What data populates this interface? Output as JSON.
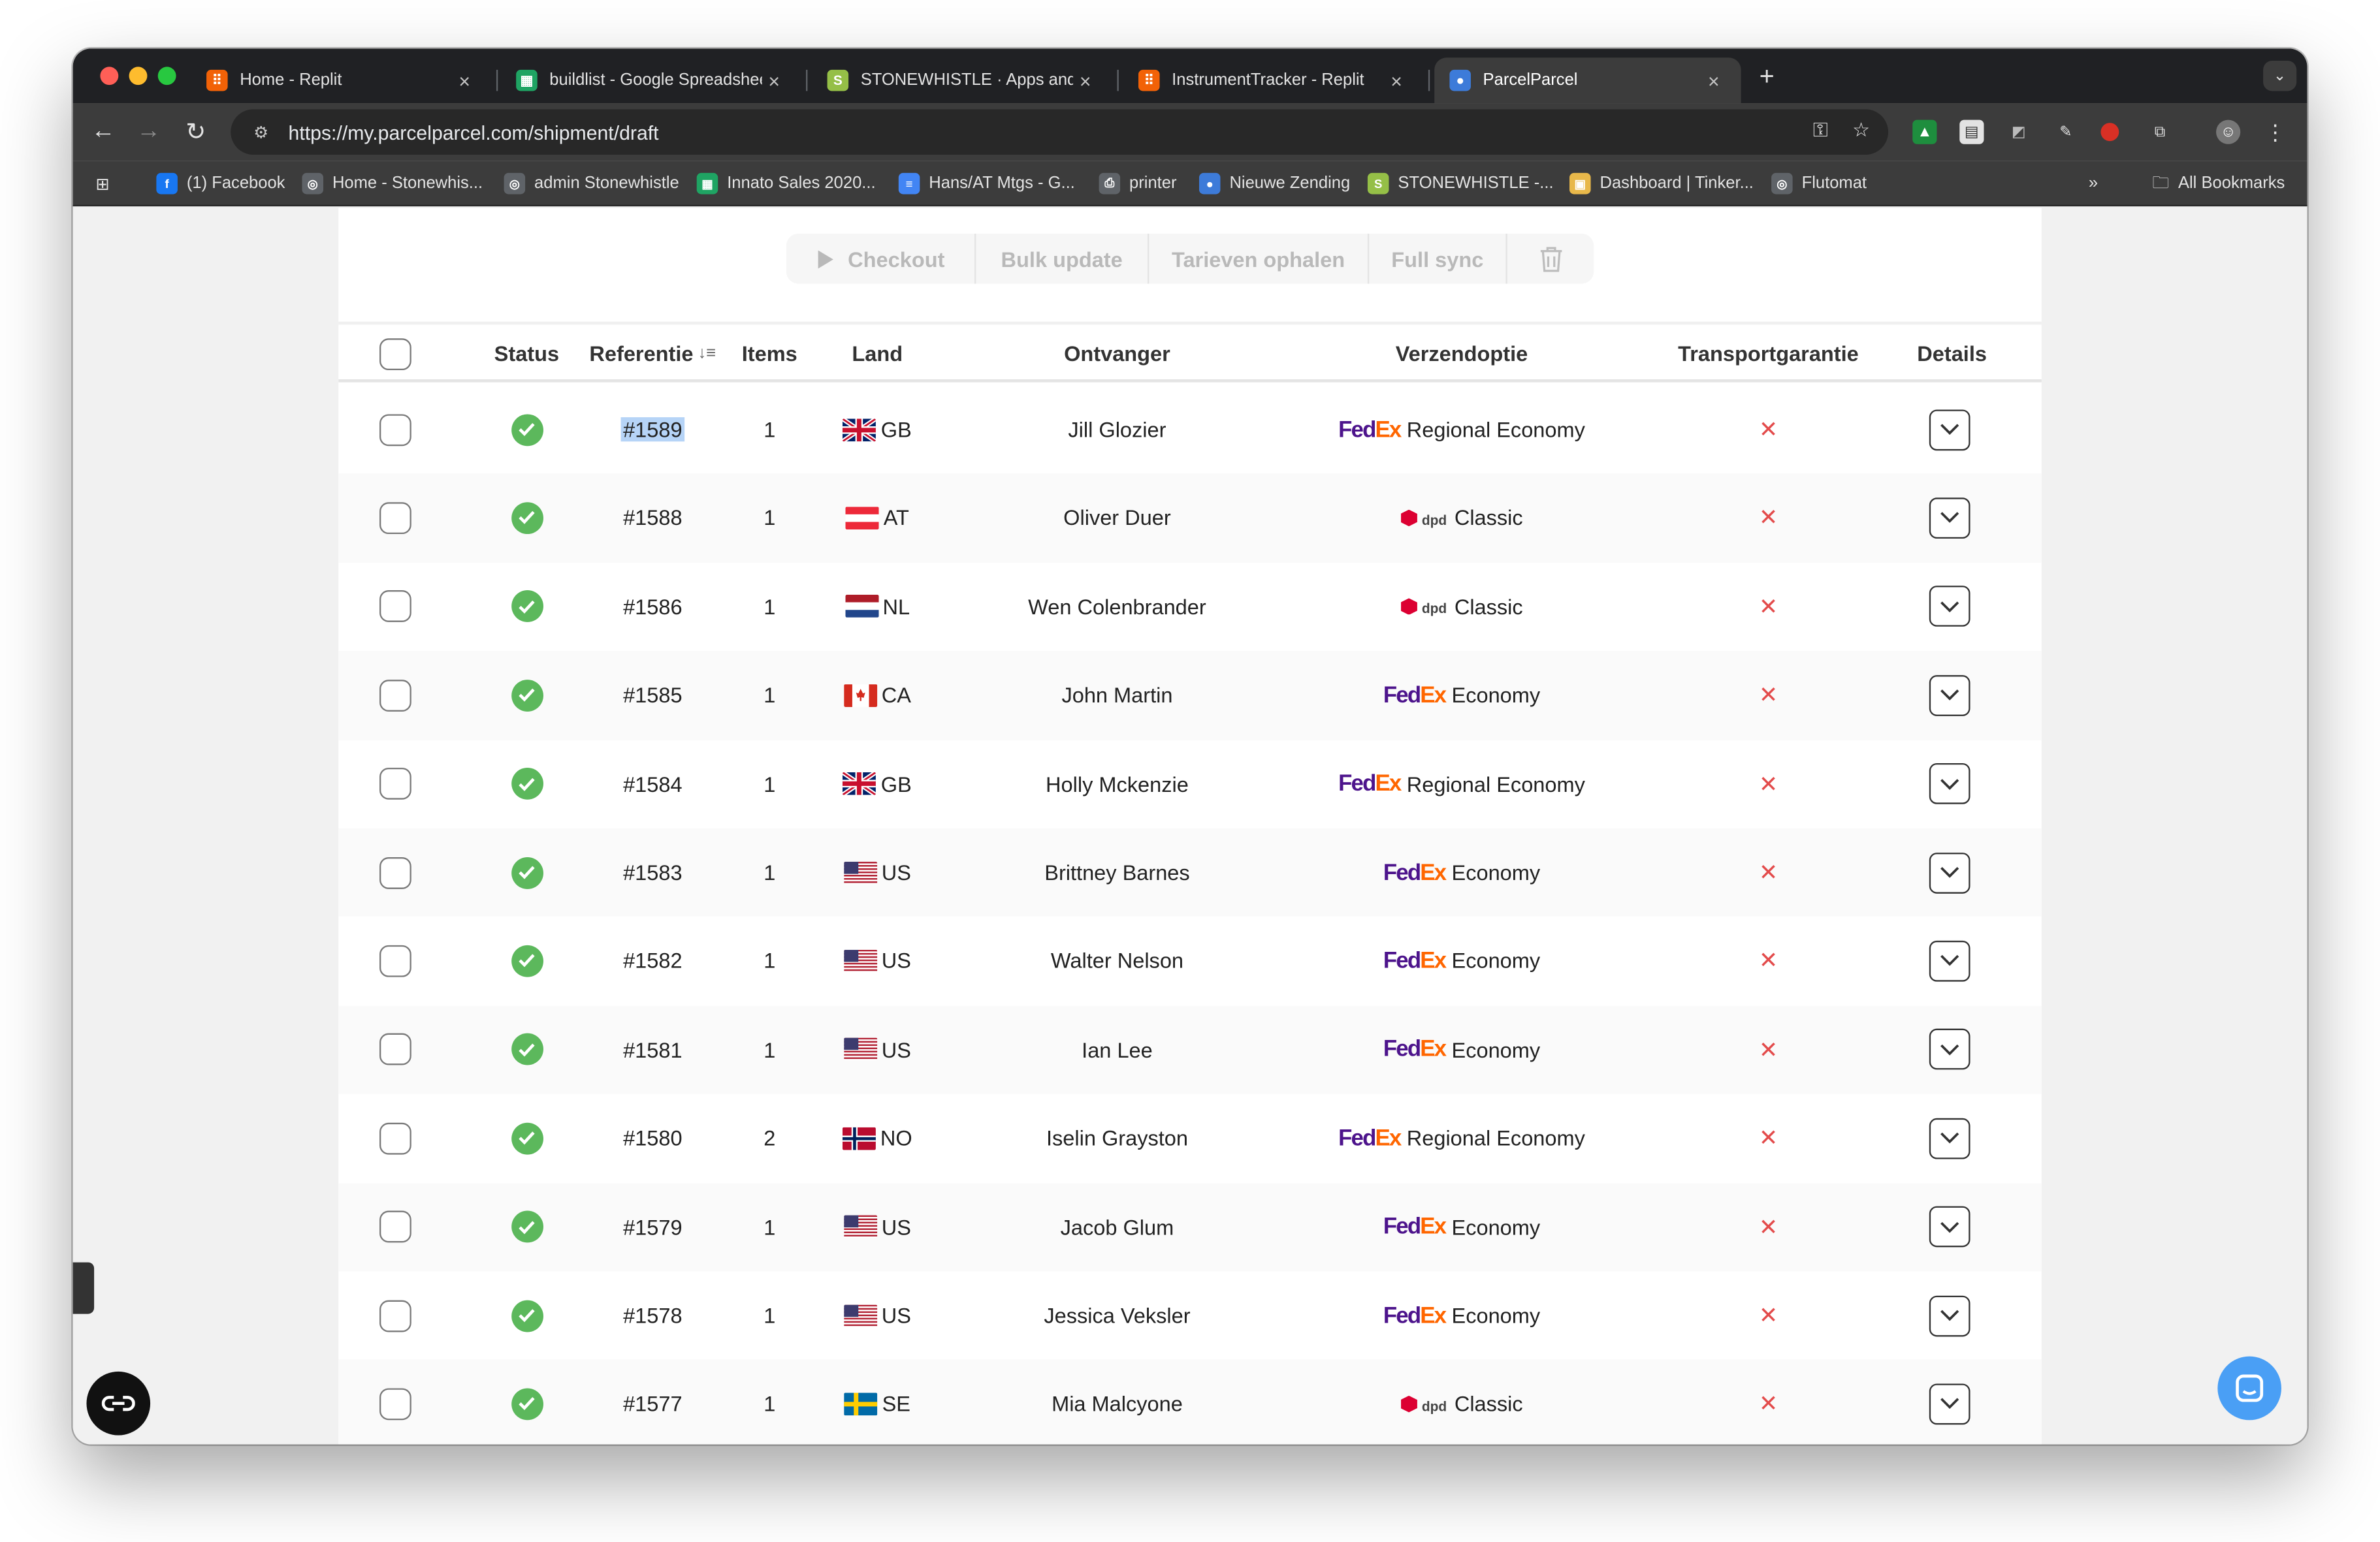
{
  "browser": {
    "tabs": [
      {
        "title": "Home - Replit",
        "icon": "replit-icon",
        "color": "#f26207"
      },
      {
        "title": "buildlist - Google Spreadshee",
        "icon": "sheets-icon",
        "color": "#1fa463"
      },
      {
        "title": "STONEWHISTLE · Apps and s",
        "icon": "shopify-icon",
        "color": "#95bf47"
      },
      {
        "title": "InstrumentTracker - Replit",
        "icon": "replit-icon",
        "color": "#f26207"
      },
      {
        "title": "ParcelParcel",
        "icon": "parcelparcel-icon",
        "color": "#3d7bd9",
        "active": true
      }
    ],
    "url": "https://my.parcelparcel.com/shipment/draft",
    "bookmarks": [
      {
        "label": "(1) Facebook",
        "icon": "facebook-icon",
        "color": "#1877f2"
      },
      {
        "label": "Home - Stonewhis...",
        "icon": "globe-icon",
        "color": "#5f6368"
      },
      {
        "label": "admin Stonewhistle",
        "icon": "globe-icon",
        "color": "#5f6368"
      },
      {
        "label": "Innato Sales 2020...",
        "icon": "sheets-icon",
        "color": "#1fa463"
      },
      {
        "label": "Hans/AT Mtgs - G...",
        "icon": "docs-icon",
        "color": "#4285f4"
      },
      {
        "label": "printer",
        "icon": "printer-icon",
        "color": "#5f6368"
      },
      {
        "label": "Nieuwe Zending",
        "icon": "parcelparcel-icon",
        "color": "#3d7bd9"
      },
      {
        "label": "STONEWHISTLE -...",
        "icon": "shopify-icon",
        "color": "#95bf47"
      },
      {
        "label": "Dashboard | Tinker...",
        "icon": "tinkercad-icon",
        "color": "#e8b84a"
      },
      {
        "label": "Flutomat",
        "icon": "globe-icon",
        "color": "#5f6368"
      }
    ],
    "all_bookmarks": "All Bookmarks"
  },
  "actions": {
    "checkout": "Checkout",
    "bulk_update": "Bulk update",
    "tarieven": "Tarieven ophalen",
    "full_sync": "Full sync"
  },
  "table": {
    "headers": {
      "status": "Status",
      "referentie": "Referentie",
      "items": "Items",
      "land": "Land",
      "ontvanger": "Ontvanger",
      "verzendoptie": "Verzendoptie",
      "transportgarantie": "Transportgarantie",
      "details": "Details"
    },
    "rows": [
      {
        "ref": "#1589",
        "items": "1",
        "country": "GB",
        "recipient": "Jill Glozier",
        "carrier": "fedex",
        "carrier_fe": "Fed",
        "carrier_ex": "Ex",
        "service": "Regional Economy",
        "selected": true
      },
      {
        "ref": "#1588",
        "items": "1",
        "country": "AT",
        "recipient": "Oliver Duer",
        "carrier": "dpd",
        "carrier_label": "dpd",
        "service": "Classic"
      },
      {
        "ref": "#1586",
        "items": "1",
        "country": "NL",
        "recipient": "Wen Colenbrander",
        "carrier": "dpd",
        "carrier_label": "dpd",
        "service": "Classic"
      },
      {
        "ref": "#1585",
        "items": "1",
        "country": "CA",
        "recipient": "John Martin",
        "carrier": "fedex",
        "carrier_fe": "Fed",
        "carrier_ex": "Ex",
        "service": "Economy"
      },
      {
        "ref": "#1584",
        "items": "1",
        "country": "GB",
        "recipient": "Holly Mckenzie",
        "carrier": "fedex",
        "carrier_fe": "Fed",
        "carrier_ex": "Ex",
        "service": "Regional Economy"
      },
      {
        "ref": "#1583",
        "items": "1",
        "country": "US",
        "recipient": "Brittney Barnes",
        "carrier": "fedex",
        "carrier_fe": "Fed",
        "carrier_ex": "Ex",
        "service": "Economy"
      },
      {
        "ref": "#1582",
        "items": "1",
        "country": "US",
        "recipient": "Walter Nelson",
        "carrier": "fedex",
        "carrier_fe": "Fed",
        "carrier_ex": "Ex",
        "service": "Economy"
      },
      {
        "ref": "#1581",
        "items": "1",
        "country": "US",
        "recipient": "Ian Lee",
        "carrier": "fedex",
        "carrier_fe": "Fed",
        "carrier_ex": "Ex",
        "service": "Economy"
      },
      {
        "ref": "#1580",
        "items": "2",
        "country": "NO",
        "recipient": "Iselin Grayston",
        "carrier": "fedex",
        "carrier_fe": "Fed",
        "carrier_ex": "Ex",
        "service": "Regional Economy"
      },
      {
        "ref": "#1579",
        "items": "1",
        "country": "US",
        "recipient": "Jacob Glum",
        "carrier": "fedex",
        "carrier_fe": "Fed",
        "carrier_ex": "Ex",
        "service": "Economy"
      },
      {
        "ref": "#1578",
        "items": "1",
        "country": "US",
        "recipient": "Jessica Veksler",
        "carrier": "fedex",
        "carrier_fe": "Fed",
        "carrier_ex": "Ex",
        "service": "Economy"
      },
      {
        "ref": "#1577",
        "items": "1",
        "country": "SE",
        "recipient": "Mia Malcyone",
        "carrier": "dpd",
        "carrier_label": "dpd",
        "service": "Classic"
      }
    ]
  },
  "colors": {
    "status_ok": "#5cb85c",
    "no_guarantee": "#e34b4b",
    "fedex_purple": "#4d148c",
    "fedex_orange": "#ff6600",
    "dpd_red": "#dc0032",
    "chat_blue": "#4a9ff5"
  }
}
